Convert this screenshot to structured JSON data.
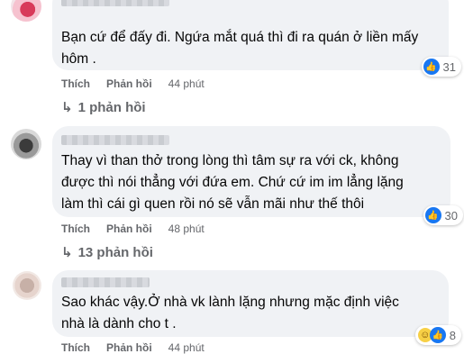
{
  "comments": [
    {
      "text_lines": [
        "Bạn cứ để đấy đi. Ngứa mắt quá thì đi ra quán ở liền mấy",
        "hôm ."
      ],
      "reaction_count": "31",
      "actions": {
        "like": "Thích",
        "reply": "Phản hồi",
        "time": "44 phút"
      },
      "replies": "1 phản hồi"
    },
    {
      "text_lines": [
        "Thay vì than thở trong lòng thì tâm sự ra với ck, không",
        "được thì nói thẳng với đứa em. Chứ cứ im im lẳng lặng",
        "làm thì cái gì quen rồi nó sẽ vẫn mãi như thế thôi"
      ],
      "reaction_count": "30",
      "actions": {
        "like": "Thích",
        "reply": "Phản hồi",
        "time": "48 phút"
      },
      "replies": "13 phản hồi"
    },
    {
      "text_lines": [
        "Sao khác vậy.Ở nhà vk lành lặng nhưng mặc định việc",
        "nhà là dành cho t ."
      ],
      "reaction_count": "8",
      "actions": {
        "like": "Thích",
        "reply": "Phản hồi",
        "time": "44 phút"
      }
    }
  ],
  "icons": {
    "like": "like-icon",
    "haha": "haha-icon",
    "reply_arrow": "reply-arrow-icon"
  },
  "colors": {
    "bubble": "#f0f2f5",
    "meta_text": "#65676b",
    "like_blue": "#1877f2"
  }
}
